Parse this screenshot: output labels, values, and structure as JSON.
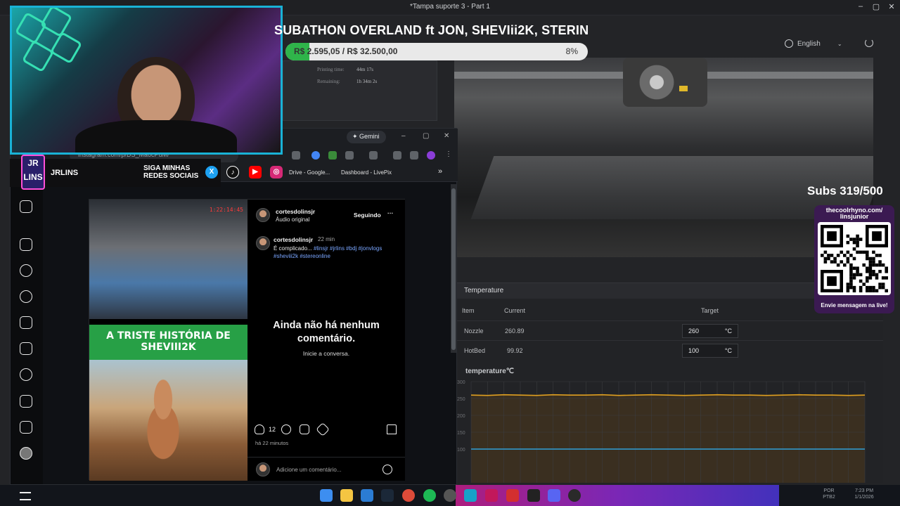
{
  "window": {
    "title": "*Tampa suporte 3 - Part 1",
    "minimize": "–",
    "maximize": "▢",
    "close": "✕"
  },
  "slicer": {
    "printing_time_label": "Printing time:",
    "printing_time_value": "44m 17s",
    "remaining_label": "Remaining:",
    "remaining_value": "1h 34m 2s",
    "language": "English",
    "temperature": {
      "title": "Temperature",
      "col_item": "Item",
      "col_current": "Current",
      "col_target": "Target",
      "rows": [
        {
          "item": "Nozzle",
          "current": "260.89",
          "target": "260",
          "unit": "°C"
        },
        {
          "item": "HotBed",
          "current": "99.92",
          "target": "100",
          "unit": "°C"
        }
      ],
      "chart_title": "temperature℃"
    }
  },
  "chart_data": {
    "type": "line",
    "title": "temperature℃",
    "ylim": [
      0,
      300
    ],
    "yticks": [
      "300",
      "250",
      "200",
      "150",
      "100"
    ],
    "series": [
      {
        "name": "Nozzle",
        "color": "#e0a020",
        "values": [
          260,
          259,
          261,
          260,
          259,
          261,
          260,
          260,
          261,
          259,
          260,
          261,
          260,
          259,
          260,
          261,
          260,
          260,
          259,
          260,
          261,
          260,
          260,
          259,
          260
        ]
      },
      {
        "name": "HotBed",
        "color": "#2f9fd8",
        "values": [
          100,
          100,
          100,
          100,
          100,
          100,
          100,
          100,
          100,
          100,
          100,
          100,
          100,
          100,
          100,
          100,
          100,
          100,
          100,
          100,
          100,
          100,
          100,
          100,
          100
        ]
      }
    ]
  },
  "overlay": {
    "title": "SUBATHON OVERLAND ft JON, SHEVIii2K, STERIN",
    "goal_text": "R$ 2.595,05 / R$ 32.500,00",
    "goal_percent_label": "8%",
    "goal_fraction": 0.08,
    "subs": "Subs 319/500",
    "qr_top": "thecoolrhyno.com/ linsjunior",
    "qr_bottom": "Envie mensagem na live!",
    "brand": "JRLINS",
    "logo": "JR LINS",
    "siga": "SIGA MINHAS REDES SOCIAIS"
  },
  "browser": {
    "gemini": "✦ Gemini",
    "url": "instagram.com/p/DS_Ma6cPuM/",
    "bookmarks": [
      "Drive - Google...",
      "Dashboard - LivePix"
    ],
    "more": "»"
  },
  "instagram": {
    "author": "cortesdolinsjr",
    "audio": "Áudio original",
    "following": "Seguindo",
    "more": "···",
    "caption_user": "cortesdolinsjr",
    "caption_time": "22 min",
    "caption_text": "É complicado...",
    "hashtags": "#linsjr #jrlins #bdj #jonvlogs #sheviii2k #stereonline",
    "no_comments": "Ainda não há nenhum comentário.",
    "start_conversation": "Inicie a conversa.",
    "likes": "12",
    "posted": "há 22 minutos",
    "comment_placeholder": "Adicione um comentário...",
    "media_banner": "A TRISTE HISTÓRIA DE SHEVIII2K",
    "media_timestamp": "1:22:14:45"
  },
  "taskbar": {
    "tray_lang": "POR PTB2",
    "tray_time": "7:23 PM",
    "tray_date": "1/1/2026"
  }
}
